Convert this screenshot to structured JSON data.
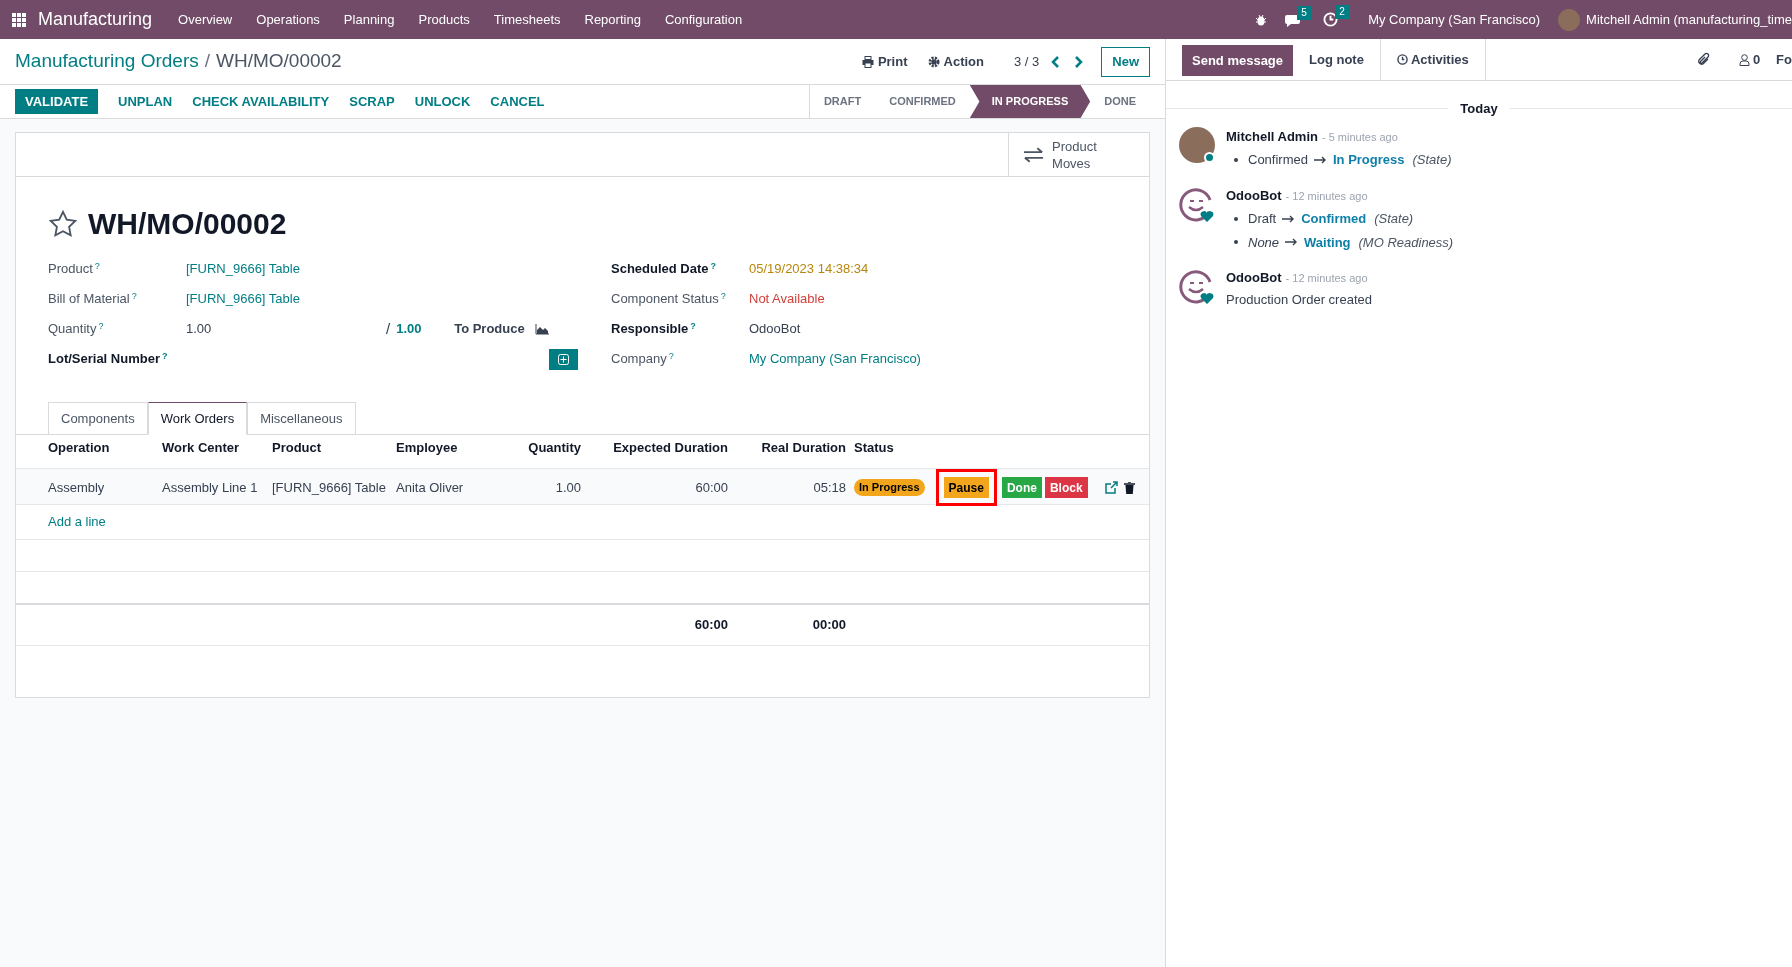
{
  "navbar": {
    "app": "Manufacturing",
    "menu": [
      "Overview",
      "Operations",
      "Planning",
      "Products",
      "Timesheets",
      "Reporting",
      "Configuration"
    ],
    "messages_count": "5",
    "activities_count": "2",
    "company": "My Company (San Francisco)",
    "user": "Mitchell Admin (manufacturing_time"
  },
  "breadcrumb": {
    "parent": "Manufacturing Orders",
    "separator": "/",
    "current": "WH/MO/00002"
  },
  "toolbar": {
    "print": "Print",
    "action": "Action",
    "pager": "3 / 3",
    "new": "New"
  },
  "actions": [
    {
      "label": "VALIDATE",
      "kind": "primary"
    },
    {
      "label": "UNPLAN",
      "kind": "link"
    },
    {
      "label": "CHECK AVAILABILITY",
      "kind": "link"
    },
    {
      "label": "SCRAP",
      "kind": "link"
    },
    {
      "label": "UNLOCK",
      "kind": "link"
    },
    {
      "label": "CANCEL",
      "kind": "link"
    }
  ],
  "stages": [
    {
      "label": "DRAFT",
      "selected": false
    },
    {
      "label": "CONFIRMED",
      "selected": false
    },
    {
      "label": "IN PROGRESS",
      "selected": true
    },
    {
      "label": "DONE",
      "selected": false
    }
  ],
  "smart_button": {
    "label": "Product Moves"
  },
  "record": {
    "name": "WH/MO/00002",
    "starred": false
  },
  "left_fields": [
    {
      "label": "Product",
      "help": "?",
      "value": "[FURN_9666] Table",
      "kind": "link"
    },
    {
      "label": "Bill of Material",
      "help": "?",
      "value": "[FURN_9666] Table",
      "kind": "link"
    },
    {
      "label": "Quantity",
      "help": "?",
      "value": "1.00",
      "kind": "quantity",
      "slash": "/",
      "produce": "1.00",
      "produce_label": "To Produce"
    },
    {
      "label": "Lot/Serial Number",
      "help": "?",
      "kind": "lot"
    }
  ],
  "right_fields": [
    {
      "label": "Scheduled Date",
      "help": "?",
      "value": "05/19/2023 14:38:34",
      "kind": "warning",
      "bold": true
    },
    {
      "label": "Component Status",
      "help": "?",
      "value": "Not Available",
      "kind": "danger",
      "bold": false
    },
    {
      "label": "Responsible",
      "help": "?",
      "value": "OdooBot",
      "kind": "text",
      "bold": true
    },
    {
      "label": "Company",
      "help": "?",
      "value": "My Company (San Francisco)",
      "kind": "link",
      "bold": false
    }
  ],
  "tabs": [
    {
      "label": "Components",
      "selected": false
    },
    {
      "label": "Work Orders",
      "selected": true
    },
    {
      "label": "Miscellaneous",
      "selected": false
    }
  ],
  "table": {
    "columns": [
      "Operation",
      "Work Center",
      "Product",
      "Employee",
      "Quantity",
      "Expected Duration",
      "Real Duration",
      "Status"
    ],
    "rows": [
      {
        "cells": [
          "Assembly",
          "Assembly Line 1",
          "[FURN_9666] Table",
          "Anita Oliver",
          "1.00",
          "60:00",
          "05:18"
        ],
        "status": "In Progress",
        "buttons": [
          {
            "label": "Pause",
            "kind": "warning",
            "highlighted": true
          },
          {
            "label": "Done",
            "kind": "success",
            "highlighted": false
          },
          {
            "label": "Block",
            "kind": "danger",
            "highlighted": false
          }
        ]
      }
    ],
    "add_line": "Add a line",
    "totals": {
      "expected": "60:00",
      "real": "00:00"
    }
  },
  "chatter": {
    "send_message": "Send message",
    "log_note": "Log note",
    "activities": "Activities",
    "followers_count": "0",
    "follow": "Fo",
    "day": "Today",
    "messages": [
      {
        "author": "Mitchell Admin",
        "kind": "user",
        "time": "- 5 minutes ago",
        "changes": [
          {
            "old": "Confirmed",
            "old_italic": false,
            "new": "In Progress",
            "field": "(State)"
          }
        ]
      },
      {
        "author": "OdooBot",
        "kind": "bot",
        "time": "- 12 minutes ago",
        "changes": [
          {
            "old": "Draft",
            "old_italic": false,
            "new": "Confirmed",
            "field": "(State)"
          },
          {
            "old": "None",
            "old_italic": true,
            "new": "Waiting",
            "field": "(MO Readiness)"
          }
        ]
      },
      {
        "author": "OdooBot",
        "kind": "bot",
        "time": "- 12 minutes ago",
        "body": "Production Order created"
      }
    ]
  }
}
